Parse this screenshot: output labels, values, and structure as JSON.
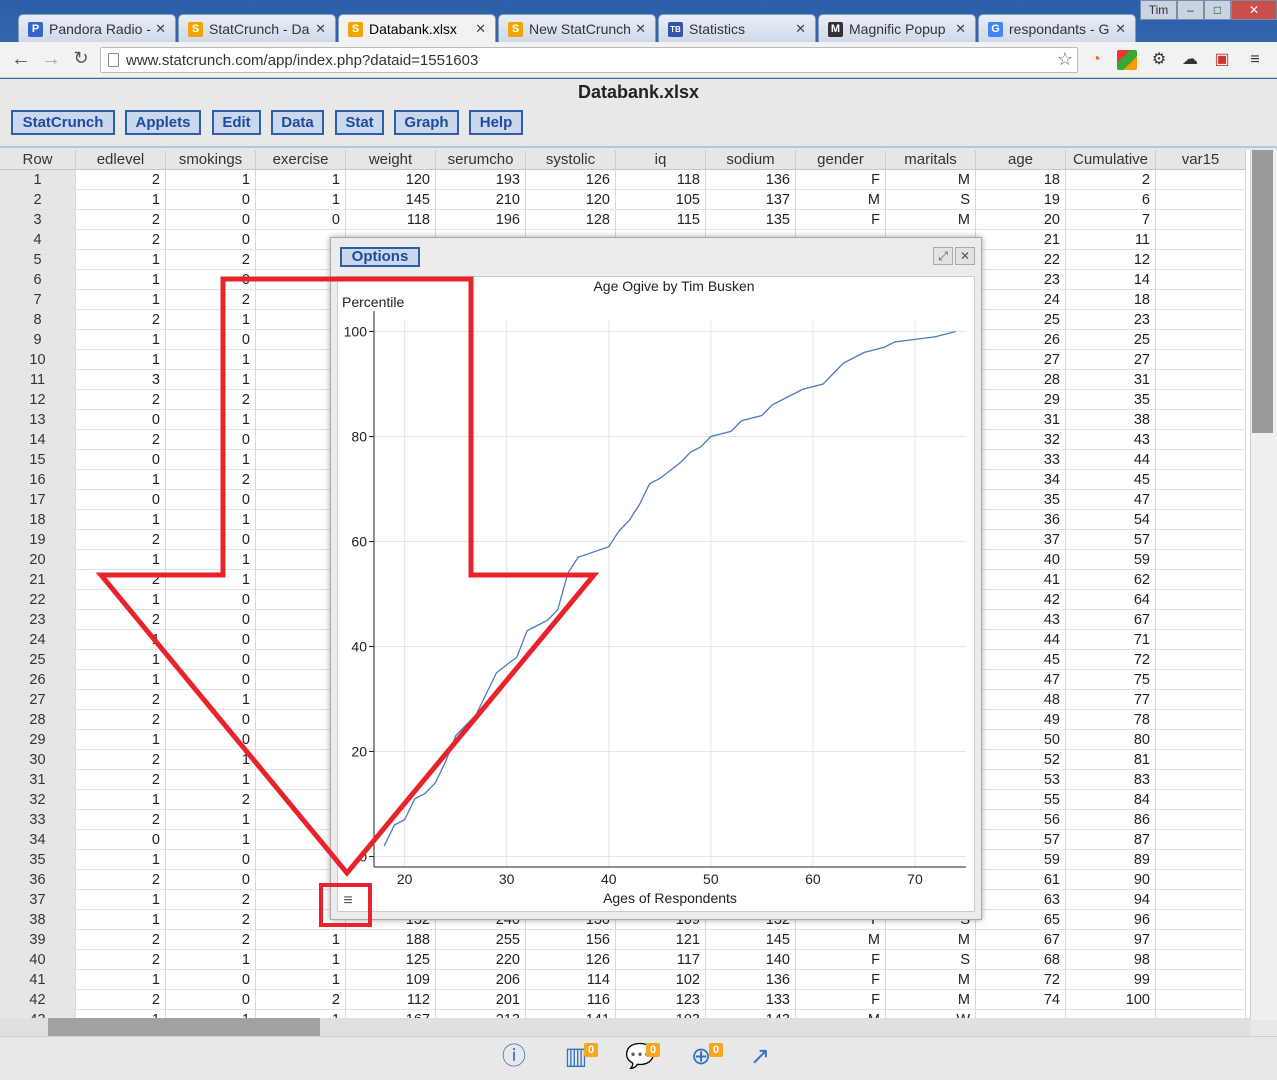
{
  "browser": {
    "user": "Tim",
    "tabs": [
      {
        "label": "Pandora Radio -",
        "icon": "P",
        "color": "#3366cc"
      },
      {
        "label": "StatCrunch - Da",
        "icon": "S",
        "color": "#f0a500"
      },
      {
        "label": "Databank.xlsx",
        "icon": "S",
        "color": "#f0a500"
      },
      {
        "label": "New StatCrunch",
        "icon": "S",
        "color": "#f0a500"
      },
      {
        "label": "Statistics",
        "icon": "TB",
        "color": "#3355aa"
      },
      {
        "label": "Magnific Popup",
        "icon": "M",
        "color": "#333333"
      },
      {
        "label": "respondants - G",
        "icon": "G",
        "color": "#4285f4"
      }
    ],
    "url": "www.statcrunch.com/app/index.php?dataid=1551603"
  },
  "app": {
    "title": "Databank.xlsx",
    "menu": [
      "StatCrunch",
      "Applets",
      "Edit",
      "Data",
      "Stat",
      "Graph",
      "Help"
    ]
  },
  "table": {
    "columns": [
      "Row",
      "edlevel",
      "smokings",
      "exercise",
      "weight",
      "serumcho",
      "systolic",
      "iq",
      "sodium",
      "gender",
      "maritals",
      "age",
      "Cumulative",
      "var15"
    ],
    "rows": [
      [
        "1",
        "2",
        "1",
        "1",
        "120",
        "193",
        "126",
        "118",
        "136",
        "F",
        "M",
        "18",
        "2",
        ""
      ],
      [
        "2",
        "1",
        "0",
        "1",
        "145",
        "210",
        "120",
        "105",
        "137",
        "M",
        "S",
        "19",
        "6",
        ""
      ],
      [
        "3",
        "2",
        "0",
        "0",
        "118",
        "196",
        "128",
        "115",
        "135",
        "F",
        "M",
        "20",
        "7",
        ""
      ],
      [
        "4",
        "2",
        "0",
        "",
        "",
        "",
        "",
        "",
        "",
        "",
        "",
        "21",
        "11",
        ""
      ],
      [
        "5",
        "1",
        "2",
        "",
        "",
        "",
        "",
        "",
        "",
        "",
        "",
        "22",
        "12",
        ""
      ],
      [
        "6",
        "1",
        "0",
        "",
        "",
        "",
        "",
        "",
        "",
        "",
        "",
        "23",
        "14",
        ""
      ],
      [
        "7",
        "1",
        "2",
        "",
        "",
        "",
        "",
        "",
        "",
        "",
        "",
        "24",
        "18",
        ""
      ],
      [
        "8",
        "2",
        "1",
        "",
        "",
        "",
        "",
        "",
        "",
        "",
        "",
        "25",
        "23",
        ""
      ],
      [
        "9",
        "1",
        "0",
        "",
        "",
        "",
        "",
        "",
        "",
        "",
        "",
        "26",
        "25",
        ""
      ],
      [
        "10",
        "1",
        "1",
        "",
        "",
        "",
        "",
        "",
        "",
        "",
        "",
        "27",
        "27",
        ""
      ],
      [
        "11",
        "3",
        "1",
        "",
        "",
        "",
        "",
        "",
        "",
        "",
        "",
        "28",
        "31",
        ""
      ],
      [
        "12",
        "2",
        "2",
        "",
        "",
        "",
        "",
        "",
        "",
        "",
        "",
        "29",
        "35",
        ""
      ],
      [
        "13",
        "0",
        "1",
        "",
        "",
        "",
        "",
        "",
        "",
        "",
        "",
        "31",
        "38",
        ""
      ],
      [
        "14",
        "2",
        "0",
        "",
        "",
        "",
        "",
        "",
        "",
        "",
        "",
        "32",
        "43",
        ""
      ],
      [
        "15",
        "0",
        "1",
        "",
        "",
        "",
        "",
        "",
        "",
        "",
        "",
        "33",
        "44",
        ""
      ],
      [
        "16",
        "1",
        "2",
        "",
        "",
        "",
        "",
        "",
        "",
        "",
        "",
        "34",
        "45",
        ""
      ],
      [
        "17",
        "0",
        "0",
        "",
        "",
        "",
        "",
        "",
        "",
        "",
        "",
        "35",
        "47",
        ""
      ],
      [
        "18",
        "1",
        "1",
        "",
        "",
        "",
        "",
        "",
        "",
        "",
        "",
        "36",
        "54",
        ""
      ],
      [
        "19",
        "2",
        "0",
        "",
        "",
        "",
        "",
        "",
        "",
        "",
        "",
        "37",
        "57",
        ""
      ],
      [
        "20",
        "1",
        "1",
        "",
        "",
        "",
        "",
        "",
        "",
        "",
        "",
        "40",
        "59",
        ""
      ],
      [
        "21",
        "2",
        "1",
        "",
        "",
        "",
        "",
        "",
        "",
        "",
        "",
        "41",
        "62",
        ""
      ],
      [
        "22",
        "1",
        "0",
        "",
        "",
        "",
        "",
        "",
        "",
        "",
        "",
        "42",
        "64",
        ""
      ],
      [
        "23",
        "2",
        "0",
        "",
        "",
        "",
        "",
        "",
        "",
        "",
        "",
        "43",
        "67",
        ""
      ],
      [
        "24",
        "1",
        "0",
        "",
        "",
        "",
        "",
        "",
        "",
        "",
        "",
        "44",
        "71",
        ""
      ],
      [
        "25",
        "1",
        "0",
        "",
        "",
        "",
        "",
        "",
        "",
        "",
        "",
        "45",
        "72",
        ""
      ],
      [
        "26",
        "1",
        "0",
        "",
        "",
        "",
        "",
        "",
        "",
        "",
        "",
        "47",
        "75",
        ""
      ],
      [
        "27",
        "2",
        "1",
        "",
        "",
        "",
        "",
        "",
        "",
        "",
        "",
        "48",
        "77",
        ""
      ],
      [
        "28",
        "2",
        "0",
        "",
        "",
        "",
        "",
        "",
        "",
        "",
        "",
        "49",
        "78",
        ""
      ],
      [
        "29",
        "1",
        "0",
        "",
        "",
        "",
        "",
        "",
        "",
        "",
        "",
        "50",
        "80",
        ""
      ],
      [
        "30",
        "2",
        "1",
        "",
        "",
        "",
        "",
        "",
        "",
        "",
        "",
        "52",
        "81",
        ""
      ],
      [
        "31",
        "2",
        "1",
        "",
        "",
        "",
        "",
        "",
        "",
        "",
        "",
        "53",
        "83",
        ""
      ],
      [
        "32",
        "1",
        "2",
        "",
        "",
        "",
        "",
        "",
        "",
        "",
        "",
        "55",
        "84",
        ""
      ],
      [
        "33",
        "2",
        "1",
        "",
        "",
        "",
        "",
        "",
        "",
        "",
        "",
        "56",
        "86",
        ""
      ],
      [
        "34",
        "0",
        "1",
        "",
        "",
        "",
        "",
        "",
        "",
        "",
        "",
        "57",
        "87",
        ""
      ],
      [
        "35",
        "1",
        "0",
        "",
        "",
        "",
        "",
        "",
        "",
        "",
        "",
        "59",
        "89",
        ""
      ],
      [
        "36",
        "2",
        "0",
        "",
        "",
        "",
        "",
        "",
        "",
        "",
        "",
        "61",
        "90",
        ""
      ],
      [
        "37",
        "1",
        "2",
        "",
        "",
        "",
        "",
        "",
        "",
        "",
        "",
        "63",
        "94",
        ""
      ],
      [
        "38",
        "1",
        "2",
        "",
        "132",
        "240",
        "130",
        "109",
        "132",
        "F",
        "S",
        "65",
        "96",
        ""
      ],
      [
        "39",
        "2",
        "2",
        "1",
        "188",
        "255",
        "156",
        "121",
        "145",
        "M",
        "M",
        "67",
        "97",
        ""
      ],
      [
        "40",
        "2",
        "1",
        "1",
        "125",
        "220",
        "126",
        "117",
        "140",
        "F",
        "S",
        "68",
        "98",
        ""
      ],
      [
        "41",
        "1",
        "0",
        "1",
        "109",
        "206",
        "114",
        "102",
        "136",
        "F",
        "M",
        "72",
        "99",
        ""
      ],
      [
        "42",
        "2",
        "0",
        "2",
        "112",
        "201",
        "116",
        "123",
        "133",
        "F",
        "M",
        "74",
        "100",
        ""
      ],
      [
        "43",
        "1",
        "1",
        "1",
        "167",
        "213",
        "141",
        "103",
        "143",
        "M",
        "W",
        "",
        "",
        ""
      ]
    ]
  },
  "popup": {
    "options_label": "Options",
    "menu_icon": "hamburger-icon"
  },
  "footer": {
    "badges": [
      "0",
      "0",
      "0"
    ]
  },
  "chart_data": {
    "type": "line",
    "title": "Age Ogive by Tim Busken",
    "xlabel": "Ages of Respondents",
    "ylabel": "Percentile",
    "xlim": [
      17,
      75
    ],
    "ylim": [
      -2,
      102
    ],
    "xticks": [
      20,
      30,
      40,
      50,
      60,
      70
    ],
    "yticks": [
      0,
      20,
      40,
      60,
      80,
      100
    ],
    "grid": true,
    "series": [
      {
        "color": "#4a7bbd",
        "x": [
          18,
          19,
          20,
          21,
          22,
          23,
          24,
          25,
          26,
          27,
          28,
          29,
          31,
          32,
          33,
          34,
          35,
          36,
          37,
          40,
          41,
          42,
          43,
          44,
          45,
          47,
          48,
          49,
          50,
          52,
          53,
          55,
          56,
          57,
          59,
          61,
          63,
          65,
          67,
          68,
          72,
          74
        ],
        "y": [
          2,
          6,
          7,
          11,
          12,
          14,
          18,
          23,
          25,
          27,
          31,
          35,
          38,
          43,
          44,
          45,
          47,
          54,
          57,
          59,
          62,
          64,
          67,
          71,
          72,
          75,
          77,
          78,
          80,
          81,
          83,
          84,
          86,
          87,
          89,
          90,
          94,
          96,
          97,
          98,
          99,
          100
        ]
      }
    ]
  },
  "colors": {
    "annotation": "#e8232c",
    "menu_border": "#2d5fa8",
    "badge": "#f5a623"
  }
}
